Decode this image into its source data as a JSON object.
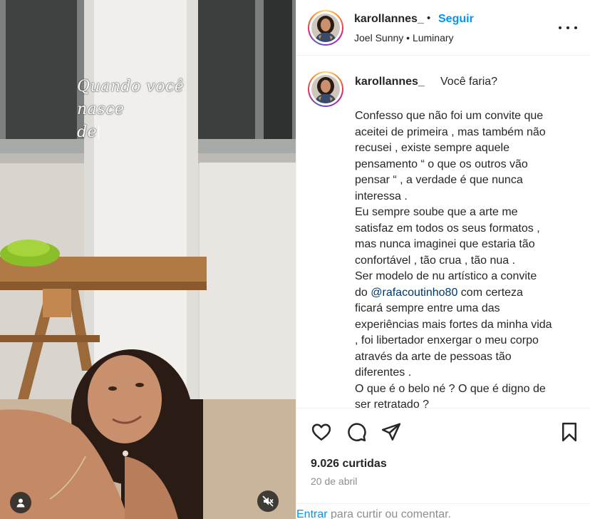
{
  "media": {
    "overlay_line1": "Quando você nasce",
    "overlay_line2": "de",
    "tag_icon": "person-tag-icon",
    "mute_icon": "speaker-muted-icon"
  },
  "header": {
    "username": "karollannes_",
    "separator": "•",
    "follow_label": "Seguir",
    "audio": "Joel Sunny • Luminary",
    "more_icon": "more-dots-icon"
  },
  "caption": {
    "username": "karollannes_",
    "first_line": "Você faria?",
    "lines": [
      "Confesso que não foi um convite que",
      "aceitei de primeira , mas também não",
      "recusei , existe sempre aquele",
      "pensamento “ o que os outros vão",
      "pensar “ , a verdade é que nunca",
      "interessa .",
      "Eu sempre soube que a arte me",
      "satisfaz em todos os seus formatos ,",
      "mas nunca imaginei que estaria tão",
      "confortável , tão crua , tão nua .",
      "Ser modelo de nu artístico a convite"
    ],
    "mention_prefix": "do ",
    "mention": "@rafacoutinho80",
    "mention_suffix": " com certeza",
    "lines_after": [
      "ficará sempre entre uma das",
      "experiências mais fortes da minha vida",
      ", foi libertador enxergar o meu corpo",
      "através da arte de pessoas tão",
      "diferentes .",
      "O que é o belo né ? O que é digno de",
      "ser retratado ?"
    ]
  },
  "actions": {
    "like_icon": "heart-icon",
    "comment_icon": "comment-icon",
    "share_icon": "send-icon",
    "save_icon": "bookmark-icon"
  },
  "likes": "9.026 curtidas",
  "date": "20 de abril",
  "login": {
    "link": "Entrar",
    "text": " para curtir ou comentar."
  },
  "colors": {
    "accent": "#0095f6",
    "mention": "#00376b",
    "text": "#262626",
    "muted": "#8e8e8e"
  }
}
